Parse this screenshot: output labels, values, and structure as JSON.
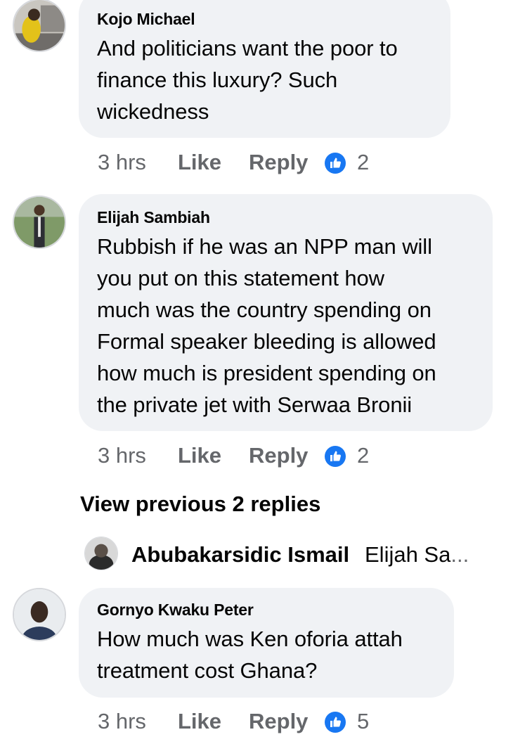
{
  "comments": [
    {
      "author": "Kojo Michael",
      "text": "And politicians want the poor to\nfinance this luxury? Such\nwickedness",
      "time": "3 hrs",
      "like_label": "Like",
      "reply_label": "Reply",
      "reaction_icon": "like-reaction-icon",
      "reaction_count": "2"
    },
    {
      "author": "Elijah Sambiah",
      "text": "Rubbish if he was an NPP man will\nyou put on this statement how\nmuch was the country spending on\nFormal speaker bleeding is allowed\nhow much is president spending on\nthe private jet with Serwaa Bronii",
      "time": "3 hrs",
      "like_label": "Like",
      "reply_label": "Reply",
      "reaction_icon": "like-reaction-icon",
      "reaction_count": "2"
    },
    {
      "author": "Gornyo Kwaku Peter",
      "text": "How much was Ken oforia attah\ntreatment cost Ghana?",
      "time": "3 hrs",
      "like_label": "Like",
      "reply_label": "Reply",
      "reaction_icon": "like-reaction-icon",
      "reaction_count": "5"
    }
  ],
  "view_previous_replies": "View previous 2 replies",
  "reply_preview": {
    "author": "Abubakarsidic Ismail",
    "text": "Elijah Sa",
    "ellipsis": "..."
  },
  "colors": {
    "bubble_bg": "#f0f2f5",
    "meta_text": "#65676b",
    "like_blue": "#1877f2"
  }
}
